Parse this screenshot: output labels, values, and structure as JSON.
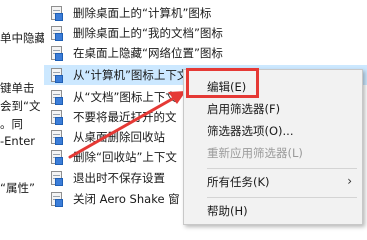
{
  "left_pane": {
    "lines": [
      "单中隐藏",
      "",
      "",
      "键单击",
      "会到“文",
      "。同",
      "-Enter",
      "",
      "“属性”"
    ]
  },
  "policy_list": {
    "items": [
      "删除桌面上的“计算机”图标",
      "删除桌面上的“我的文档”图标",
      "在桌面上隐藏“网络位置”图标",
      "从“计算机”图标上下文",
      "从“文档”图标上下文",
      "不要将最近打开的文",
      "从桌面删除回收站",
      "删除“回收站”上下文",
      "退出时不保存设置",
      "关闭 Aero Shake 窗"
    ],
    "selected_index": 3
  },
  "context_menu": {
    "edit": "编辑(E)",
    "enable_filter": "启用筛选器(F)",
    "filter_options": "筛选器选项(O)...",
    "reapply_filter": "重新应用筛选器(L)",
    "all_tasks": "所有任务(K)",
    "help": "帮助(H)"
  },
  "colors": {
    "selection": "#cce8ff",
    "annotation": "#e53935"
  },
  "icons": {
    "policy_item": "policy-setting-icon",
    "submenu": "chevron-right-icon",
    "annotation_arrow": "red-arrow"
  }
}
